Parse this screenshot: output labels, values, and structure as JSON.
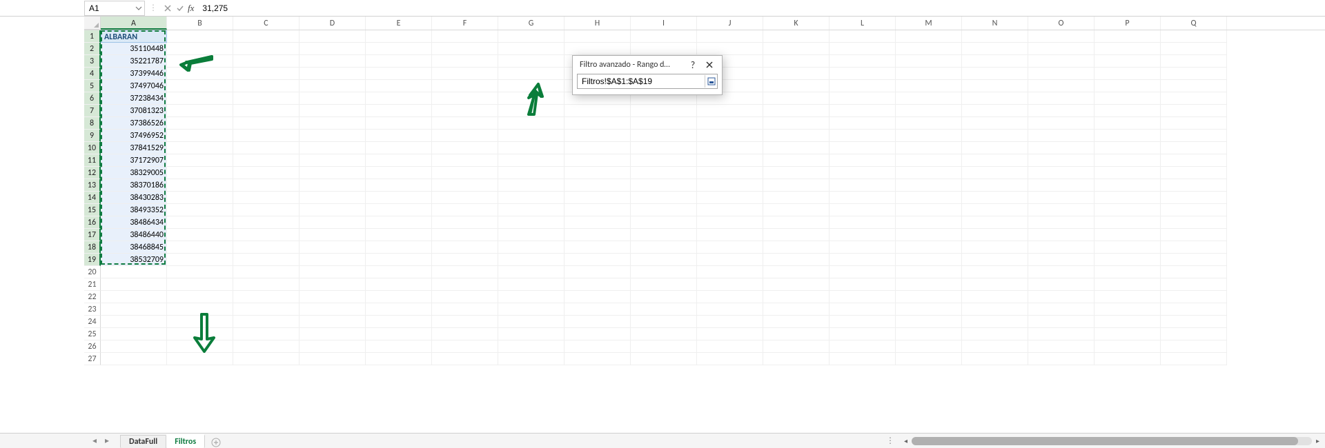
{
  "formula_bar": {
    "name_box": "A1",
    "formula": "31,275"
  },
  "columns": [
    "A",
    "B",
    "C",
    "D",
    "E",
    "F",
    "G",
    "H",
    "I",
    "J",
    "K",
    "L",
    "M",
    "N",
    "O",
    "P",
    "Q"
  ],
  "header_cell": {
    "label": "ALBARAN"
  },
  "data": [
    "35110448",
    "35221787",
    "37399446",
    "37497046",
    "37238434",
    "37081323",
    "37386526",
    "37496952",
    "37841529",
    "37172907",
    "38329005",
    "38370186",
    "38430283",
    "38493352",
    "38486434",
    "38486440",
    "38468845",
    "38532709"
  ],
  "dialog": {
    "title": "Filtro avanzado - Rango d…",
    "range_value": "Filtros!$A$1:$A$19"
  },
  "sheets": {
    "inactive": "DataFull",
    "active": "Filtros"
  },
  "rows_total": 27
}
